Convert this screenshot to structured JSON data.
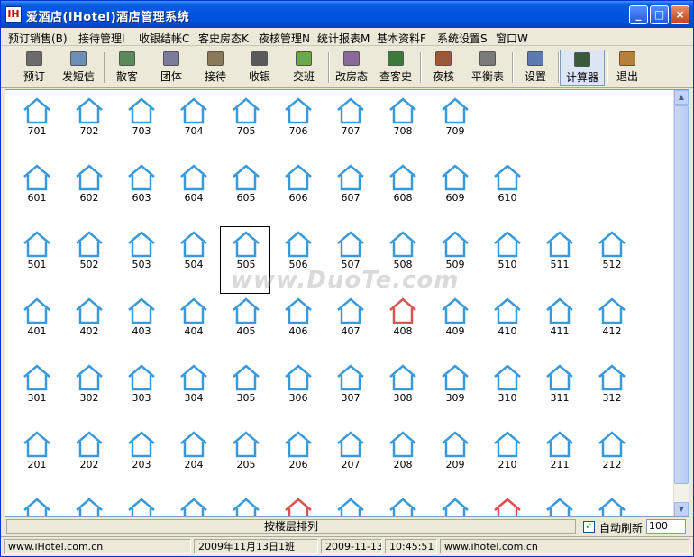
{
  "title": "爱酒店(iHotel)酒店管理系统",
  "app_icon_text": "IH",
  "window_buttons": {
    "minimize": "_",
    "maximize": "□",
    "close": "×"
  },
  "menu": [
    "预订销售(B)",
    "接待管理I",
    "收银结帐C",
    "客史房态K",
    "夜核管理N",
    "统计报表M",
    "基本资料F",
    "系统设置S",
    "窗口W"
  ],
  "toolbar": [
    {
      "label": "预订",
      "icon": "phone-icon",
      "color": "#6b6b6b"
    },
    {
      "label": "发短信",
      "icon": "message-icon",
      "color": "#6b8fb5"
    },
    {
      "label": "散客",
      "icon": "guest-icon",
      "color": "#5a8a5a"
    },
    {
      "label": "团体",
      "icon": "group-icon",
      "color": "#7a7a9a"
    },
    {
      "label": "接待",
      "icon": "reception-icon",
      "color": "#8a7a5a"
    },
    {
      "label": "收银",
      "icon": "cashier-icon",
      "color": "#5a5a5a"
    },
    {
      "label": "交班",
      "icon": "shift-icon",
      "color": "#6aa84f"
    },
    {
      "label": "改房态",
      "icon": "room-status-icon",
      "color": "#8a6a9a"
    },
    {
      "label": "查客史",
      "icon": "history-icon",
      "color": "#3a7a3a"
    },
    {
      "label": "夜核",
      "icon": "night-audit-icon",
      "color": "#9a5a3a"
    },
    {
      "label": "平衡表",
      "icon": "balance-icon",
      "color": "#7a7a7a"
    },
    {
      "label": "设置",
      "icon": "settings-icon",
      "color": "#5a7ab0"
    },
    {
      "label": "计算器",
      "icon": "calculator-icon",
      "color": "#3a5a3a"
    },
    {
      "label": "退出",
      "icon": "exit-icon",
      "color": "#b5803a"
    }
  ],
  "floors": [
    {
      "rooms": [
        "701",
        "702",
        "703",
        "704",
        "705",
        "706",
        "707",
        "708",
        "709"
      ]
    },
    {
      "rooms": [
        "601",
        "602",
        "603",
        "604",
        "605",
        "606",
        "607",
        "608",
        "609",
        "610"
      ]
    },
    {
      "rooms": [
        "501",
        "502",
        "503",
        "504",
        "505",
        "506",
        "507",
        "508",
        "509",
        "510",
        "511",
        "512"
      ]
    },
    {
      "rooms": [
        "401",
        "402",
        "403",
        "404",
        "405",
        "406",
        "407",
        "408",
        "409",
        "410",
        "411",
        "412"
      ]
    },
    {
      "rooms": [
        "301",
        "302",
        "303",
        "304",
        "305",
        "306",
        "307",
        "308",
        "309",
        "310",
        "311",
        "312"
      ]
    },
    {
      "rooms": [
        "201",
        "202",
        "203",
        "204",
        "205",
        "206",
        "207",
        "208",
        "209",
        "210",
        "211",
        "212"
      ]
    }
  ],
  "selected_room": "505",
  "watermark": "www.DuoTe.com",
  "status": {
    "sort_mode": "按楼层排列",
    "auto_refresh_label": "自动刷新",
    "auto_refresh_checked": "✓",
    "refresh_value": "100",
    "website_left": "www.iHotel.com.cn",
    "shift": "2009年11月13日1班",
    "date": "2009-11-13",
    "time": "10:45:51",
    "website_right": "www.ihotel.com.cn"
  },
  "colors": {
    "room_vacant": "#3a9ad9",
    "room_occupied": "#d9534f",
    "titlebar": "#0054e3"
  }
}
